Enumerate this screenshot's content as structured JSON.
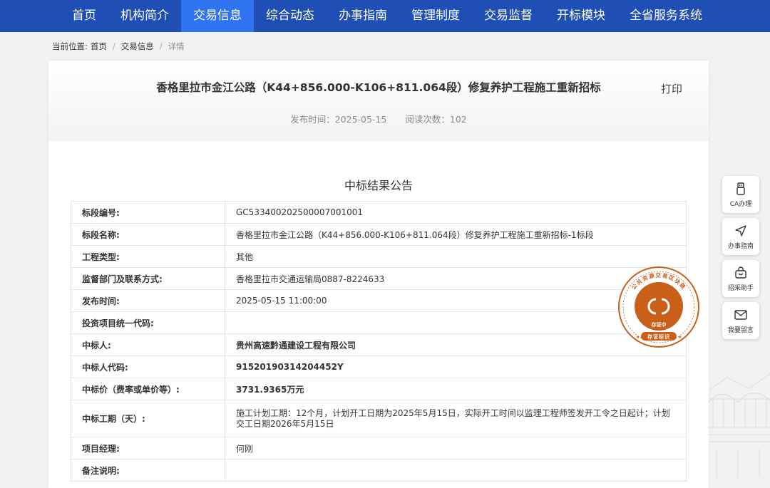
{
  "nav": {
    "items": [
      {
        "label": "首页"
      },
      {
        "label": "机构简介"
      },
      {
        "label": "交易信息"
      },
      {
        "label": "综合动态"
      },
      {
        "label": "办事指南"
      },
      {
        "label": "管理制度"
      },
      {
        "label": "交易监督"
      },
      {
        "label": "开标模块"
      },
      {
        "label": "全省服务系统"
      }
    ],
    "active_index": 2
  },
  "breadcrumb": {
    "prefix": "当前位置:",
    "items": [
      "首页",
      "交易信息"
    ],
    "current": "详情",
    "separator": "/"
  },
  "article": {
    "title": "香格里拉市金江公路（K44+856.000-K106+811.064段）修复养护工程施工重新招标",
    "print_label": "打印",
    "publish_time": "发布时间：2025-05-15",
    "read_count": "阅读次数：102",
    "notice_title": "中标结果公告"
  },
  "table": {
    "rows": [
      {
        "label": "标段编号:",
        "value": "GC533400202500007001001"
      },
      {
        "label": "标段名称:",
        "value": "香格里拉市金江公路（K44+856.000-K106+811.064段）修复养护工程施工重新招标-1标段"
      },
      {
        "label": "工程类型:",
        "value": "其他"
      },
      {
        "label": "监督部门及联系方式:",
        "value": "香格里拉市交通运输局0887-8224633"
      },
      {
        "label": "发布时间:",
        "value": "2025-05-15 11:00:00"
      },
      {
        "label": "投资项目统一代码:",
        "value": ""
      },
      {
        "label": "中标人:",
        "value": "贵州高速黔通建设工程有限公司"
      },
      {
        "label": "中标人代码:",
        "value": "91520190314204452Y"
      },
      {
        "label": "中标价（费率或单价等）:",
        "value": "3731.9365万元"
      },
      {
        "label": "中标工期（天）:",
        "value": "施工计划工期：12个月，计划开工日期为2025年5月15日，实际开工时间以监理工程师签发开工令之日起计；计划交工日期2026年5月15日"
      },
      {
        "label": "项目经理:",
        "value": "何刚"
      },
      {
        "label": "备注说明:",
        "value": ""
      }
    ]
  },
  "seal": {
    "arc_text": "公共资源交易区块链",
    "status": "存证中",
    "bottom_text": "存证标识"
  },
  "tools": [
    {
      "label": "CA办理",
      "icon": "usb-key-icon"
    },
    {
      "label": "办事指南",
      "icon": "send-arrow-icon"
    },
    {
      "label": "招采助手",
      "icon": "shopping-basket-icon"
    },
    {
      "label": "我要留言",
      "icon": "mail-icon"
    }
  ],
  "colors": {
    "nav_bg": "#1f4fb4",
    "nav_active": "#2f73f0",
    "seal": "#c8601a"
  }
}
